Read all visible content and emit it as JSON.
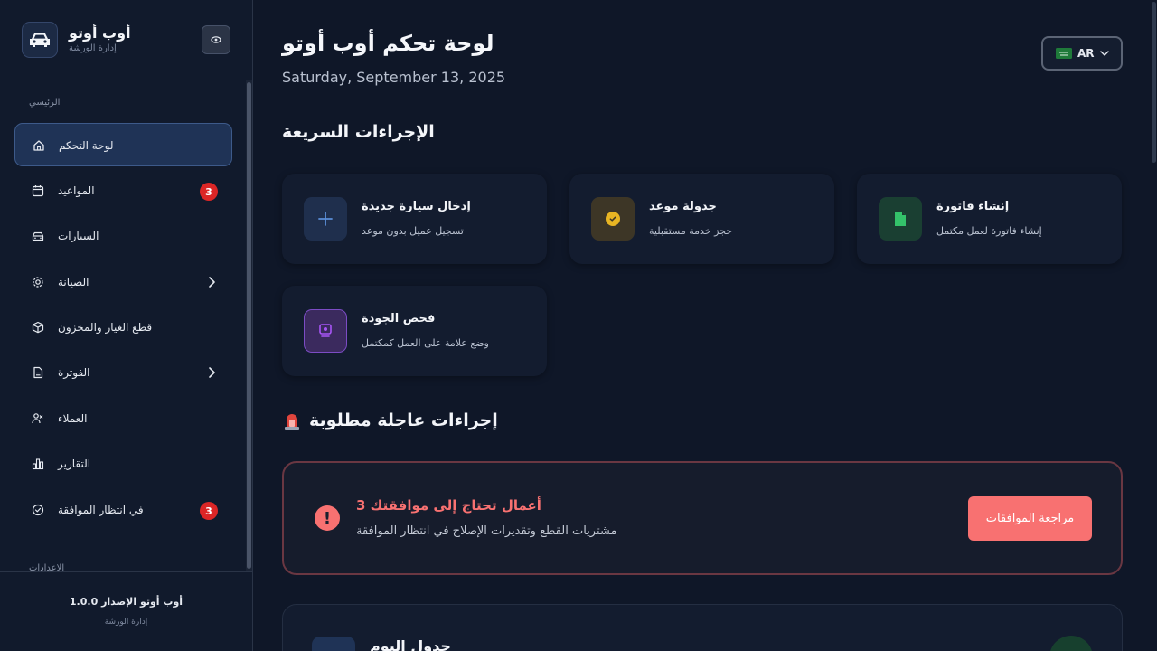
{
  "sidebar": {
    "brand_name": "أوب أوتو",
    "brand_sub": "إدارة الورشة",
    "section_main": "الرئيسي",
    "section_settings": "الإعدادات",
    "items": [
      {
        "label": "لوحة التحكم",
        "icon": "home-icon",
        "active": true
      },
      {
        "label": "المواعيد",
        "icon": "calendar-icon",
        "badge": "3"
      },
      {
        "label": "السيارات",
        "icon": "car-icon"
      },
      {
        "label": "الصيانة",
        "icon": "gear-icon",
        "expandable": true
      },
      {
        "label": "قطع الغيار والمخزون",
        "icon": "box-icon"
      },
      {
        "label": "الفوترة",
        "icon": "file-icon",
        "expandable": true
      },
      {
        "label": "العملاء",
        "icon": "users-icon"
      },
      {
        "label": "التقارير",
        "icon": "bar-chart-icon"
      },
      {
        "label": "في انتظار الموافقة",
        "icon": "check-circle-icon",
        "badge": "3"
      }
    ],
    "footer_version": "أوب أوتو الإصدار 1.0.0",
    "footer_sub": "إدارة الورشة"
  },
  "header": {
    "title": "لوحة تحكم أوب أوتو",
    "date": "Saturday, September 13, 2025",
    "language": "AR"
  },
  "quick_actions": {
    "title": "الإجراءات السريعة",
    "cards": [
      {
        "title": "إدخال سيارة جديدة",
        "desc": "تسجيل عميل بدون موعد",
        "icon": "plus-icon",
        "color": "#5b8fd8"
      },
      {
        "title": "جدولة موعد",
        "desc": "حجز خدمة مستقبلية",
        "icon": "clock-icon",
        "color": "#e8b523"
      },
      {
        "title": "إنشاء فاتورة",
        "desc": "إنشاء فاتورة لعمل مكتمل",
        "icon": "document-icon",
        "color": "#34c26a"
      },
      {
        "title": "فحص الجودة",
        "desc": "وضع علامة على العمل كمكتمل",
        "icon": "inspection-icon",
        "color": "#a855f7"
      }
    ]
  },
  "urgent": {
    "title": "إجراءات عاجلة مطلوبة",
    "card_title": "أعمال تحتاج إلى موافقتك 3",
    "card_desc": "مشتريات القطع وتقديرات الإصلاح في انتظار الموافقة",
    "button": "مراجعة الموافقات"
  },
  "schedule": {
    "title": "جدول اليوم"
  }
}
